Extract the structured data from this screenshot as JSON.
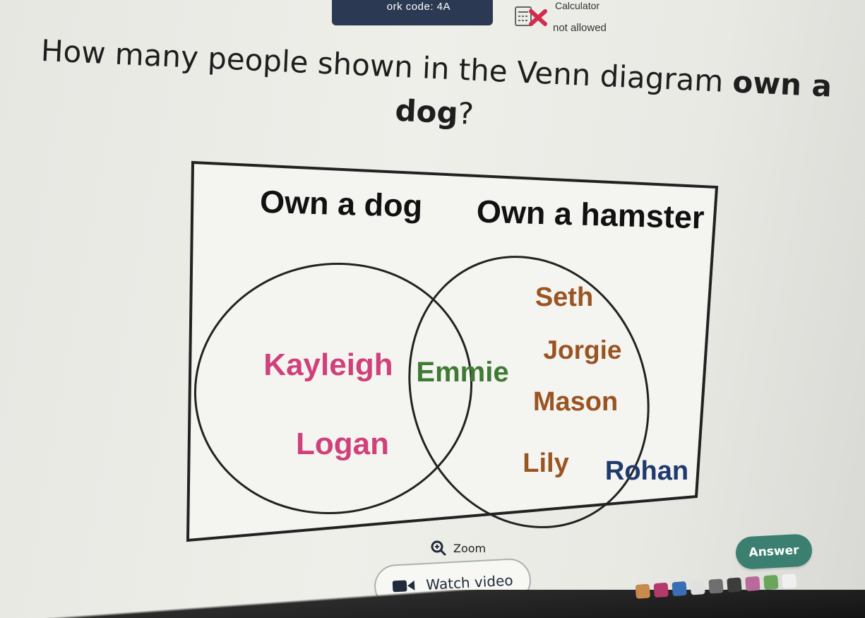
{
  "header": {
    "bookwork_code": "ork code: 4A",
    "calculator_title": "Calculator",
    "calculator_status": "not allowed"
  },
  "question": {
    "text_part1": "How many people shown in the Venn diagram ",
    "text_bold": "own a dog",
    "text_end": "?"
  },
  "venn": {
    "left_label": "Own a dog",
    "right_label": "Own a hamster",
    "names": {
      "seth": "Seth",
      "kayleigh": "Kayleigh",
      "emmie": "Emmie",
      "jorgie": "Jorgie",
      "mason": "Mason",
      "logan": "Logan",
      "lily": "Lily",
      "rohan": "Rohan"
    },
    "colors": {
      "kayleigh": "#d0407a",
      "logan": "#d0407a",
      "emmie": "#3f7a34",
      "hamster_names": "#9a5422"
    }
  },
  "controls": {
    "zoom_label": "Zoom",
    "answer_label": "Answer",
    "watch_video_label": "Watch video"
  },
  "icons": [
    "calculator-icon",
    "cross-icon",
    "zoom-icon",
    "video-icon"
  ]
}
